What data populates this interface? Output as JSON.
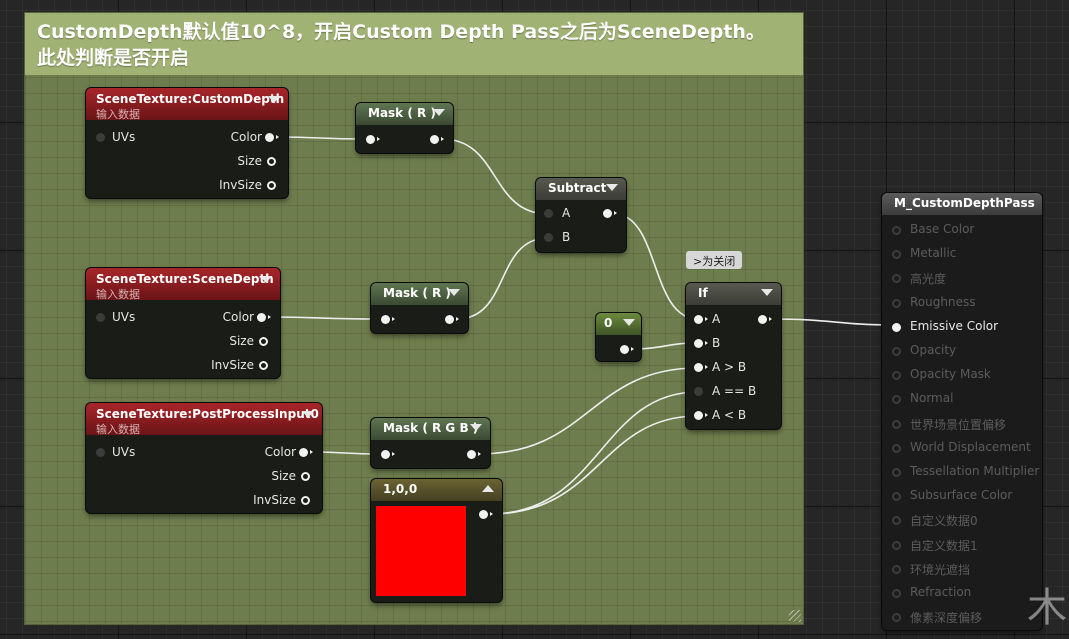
{
  "comment": {
    "line1": "CustomDepth默认值10^8，开启Custom Depth Pass之后为SceneDepth。",
    "line2": "此处判断是否开启"
  },
  "nodes": {
    "custom_depth": {
      "title": "SceneTexture:CustomDepth",
      "subtitle": "输入数据",
      "input": "UVs",
      "outputs": [
        "Color",
        "Size",
        "InvSize"
      ]
    },
    "scene_depth": {
      "title": "SceneTexture:SceneDepth",
      "subtitle": "输入数据",
      "input": "UVs",
      "outputs": [
        "Color",
        "Size",
        "InvSize"
      ]
    },
    "post_process": {
      "title": "SceneTexture:PostProcessInput0",
      "subtitle": "输入数据",
      "input": "UVs",
      "outputs": [
        "Color",
        "Size",
        "InvSize"
      ]
    },
    "mask1": {
      "title": "Mask ( R )"
    },
    "mask2": {
      "title": "Mask ( R )"
    },
    "mask3": {
      "title": "Mask ( R G B )"
    },
    "subtract": {
      "title": "Subtract",
      "inputs": [
        "A",
        "B"
      ]
    },
    "constant0": {
      "title": "0"
    },
    "color_const": {
      "title": "1,0,0",
      "color": "#ff0000"
    },
    "if_node": {
      "title": "If",
      "tooltip": ">为关闭",
      "inputs": [
        "A",
        "B",
        "A > B",
        "A == B",
        "A < B"
      ]
    }
  },
  "result": {
    "title": "M_CustomDepthPass",
    "pins": [
      {
        "label": "Base Color",
        "active": false
      },
      {
        "label": "Metallic",
        "active": false
      },
      {
        "label": "高光度",
        "active": false
      },
      {
        "label": "Roughness",
        "active": false
      },
      {
        "label": "Emissive Color",
        "active": true
      },
      {
        "label": "Opacity",
        "active": false
      },
      {
        "label": "Opacity Mask",
        "active": false
      },
      {
        "label": "Normal",
        "active": false
      },
      {
        "label": "世界场景位置偏移",
        "active": false
      },
      {
        "label": "World Displacement",
        "active": false
      },
      {
        "label": "Tessellation Multiplier",
        "active": false
      },
      {
        "label": "Subsurface Color",
        "active": false
      },
      {
        "label": "自定义数据0",
        "active": false
      },
      {
        "label": "自定义数据1",
        "active": false
      },
      {
        "label": "环境光遮挡",
        "active": false
      },
      {
        "label": "Refraction",
        "active": false
      },
      {
        "label": "像素深度偏移",
        "active": false
      }
    ]
  },
  "watermark": "木"
}
